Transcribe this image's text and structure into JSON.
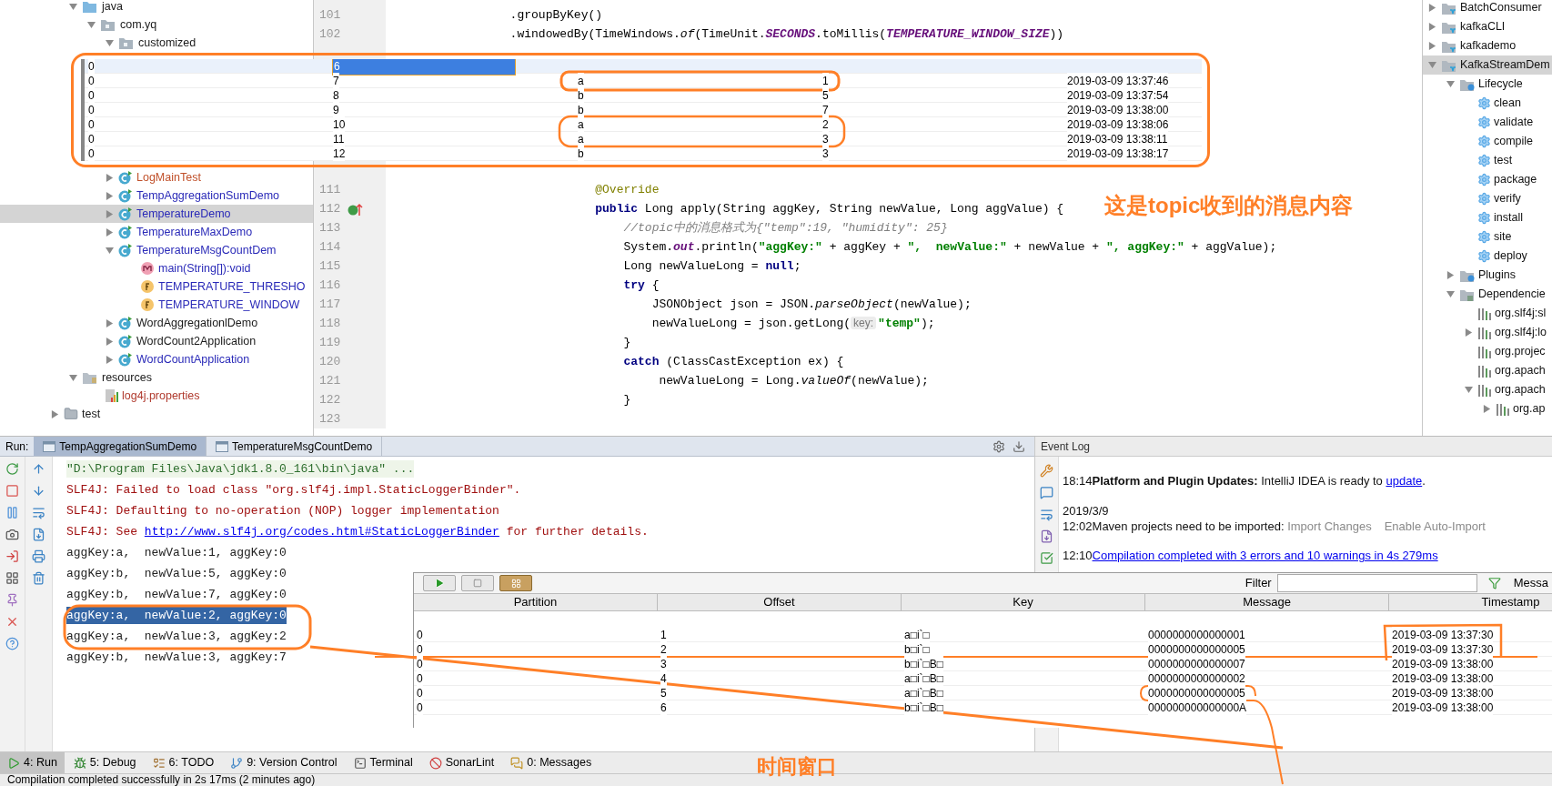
{
  "project_tree": {
    "items": [
      {
        "label": "java",
        "kind": "source-folder",
        "expanded": true,
        "selected": false,
        "children": [
          {
            "label": "com.yq",
            "kind": "package",
            "expanded": true,
            "selected": false,
            "children": [
              {
                "label": "customized",
                "kind": "package",
                "expanded": true,
                "selected": false
              },
              {
                "label": "LogMainTest",
                "kind": "class",
                "expanded": false,
                "selected": false,
                "color": "#c0502a"
              },
              {
                "label": "TempAggregationSumDemo",
                "kind": "class",
                "expanded": false,
                "selected": false,
                "color": "#2a2ab8"
              },
              {
                "label": "TemperatureDemo",
                "kind": "class",
                "expanded": false,
                "selected": true,
                "color": "#2a2ab8"
              },
              {
                "label": "TemperatureMaxDemo",
                "kind": "class",
                "expanded": false,
                "selected": false,
                "color": "#2a2ab8"
              },
              {
                "label": "TemperatureMsgCountDem",
                "kind": "class",
                "expanded": true,
                "selected": false,
                "color": "#2a2ab8",
                "children": [
                  {
                    "label": "main(String[]):void",
                    "kind": "method",
                    "selected": false,
                    "color": "#2a2ab8"
                  },
                  {
                    "label": "TEMPERATURE_THRESHO",
                    "kind": "field",
                    "selected": false,
                    "color": "#2a2ab8"
                  },
                  {
                    "label": "TEMPERATURE_WINDOW",
                    "kind": "field",
                    "selected": false,
                    "color": "#2a2ab8"
                  }
                ]
              },
              {
                "label": "WordAggregationlDemo",
                "kind": "class",
                "expanded": false,
                "selected": false,
                "color": "#1a1a1a"
              },
              {
                "label": "WordCount2Application",
                "kind": "class",
                "expanded": false,
                "selected": false,
                "color": "#1a1a1a"
              },
              {
                "label": "WordCountApplication",
                "kind": "class",
                "expanded": false,
                "selected": false,
                "color": "#2a2ab8"
              }
            ]
          }
        ]
      },
      {
        "label": "resources",
        "kind": "resource-folder",
        "expanded": true,
        "selected": false,
        "children": [
          {
            "label": "log4j.properties",
            "kind": "properties",
            "selected": false,
            "color": "#b03a2e"
          }
        ]
      }
    ],
    "after": [
      {
        "label": "test",
        "kind": "folder",
        "expanded": false,
        "selected": false,
        "color": "#1a1a1a"
      }
    ]
  },
  "editor": {
    "top_lines": [
      {
        "number": "101",
        "segments": [
          {
            "kind": "plain",
            "text": "                 .groupByKey()"
          }
        ]
      },
      {
        "number": "102",
        "segments": [
          {
            "kind": "plain",
            "text": "                 .windowedBy(TimeWindows."
          },
          {
            "kind": "italic",
            "text": "of"
          },
          {
            "kind": "plain",
            "text": "(TimeUnit."
          },
          {
            "kind": "static",
            "text": "SECONDS"
          },
          {
            "kind": "plain",
            "text": ".toMillis("
          },
          {
            "kind": "static",
            "text": "TEMPERATURE_WINDOW_SIZE"
          },
          {
            "kind": "plain",
            "text": "))"
          }
        ]
      }
    ],
    "lines": [
      {
        "number": "111",
        "segments": [
          {
            "kind": "annotation",
            "text": "                             @Override"
          }
        ]
      },
      {
        "number": "112",
        "gutter_mark": true,
        "segments": [
          {
            "kind": "keyword",
            "text": "                             public"
          },
          {
            "kind": "plain",
            "text": " Long apply(String aggKey, String newValue, Long aggValue) {"
          }
        ]
      },
      {
        "number": "113",
        "segments": [
          {
            "kind": "comment",
            "text": "                                 //topic中的消息格式为{\"temp\":19, \"humidity\": 25}"
          }
        ]
      },
      {
        "number": "114",
        "segments": [
          {
            "kind": "plain",
            "text": "                                 System."
          },
          {
            "kind": "static",
            "text": "out"
          },
          {
            "kind": "plain",
            "text": ".println("
          },
          {
            "kind": "string",
            "text": "\"aggKey:\""
          },
          {
            "kind": "plain",
            "text": " + aggKey + "
          },
          {
            "kind": "string",
            "text": "\",  newValue:\""
          },
          {
            "kind": "plain",
            "text": " + newValue + "
          },
          {
            "kind": "string",
            "text": "\", aggKey:\""
          },
          {
            "kind": "plain",
            "text": " + aggValue);"
          }
        ]
      },
      {
        "number": "115",
        "segments": [
          {
            "kind": "plain",
            "text": "                                 Long newValueLong = "
          },
          {
            "kind": "keyword",
            "text": "null"
          },
          {
            "kind": "plain",
            "text": ";"
          }
        ]
      },
      {
        "number": "116",
        "segments": [
          {
            "kind": "keyword",
            "text": "                                 try"
          },
          {
            "kind": "plain",
            "text": " {"
          }
        ]
      },
      {
        "number": "117",
        "segments": [
          {
            "kind": "plain",
            "text": "                                     JSONObject json = JSON."
          },
          {
            "kind": "italic",
            "text": "parseObject"
          },
          {
            "kind": "plain",
            "text": "(newValue);"
          }
        ]
      },
      {
        "number": "118",
        "segments": [
          {
            "kind": "plain",
            "text": "                                     newValueLong = json.getLong("
          },
          {
            "kind": "hint",
            "text": "key:"
          },
          {
            "kind": "string",
            "text": "\"temp\""
          },
          {
            "kind": "plain",
            "text": ");"
          }
        ]
      },
      {
        "number": "119",
        "segments": [
          {
            "kind": "plain",
            "text": "                                 }"
          }
        ]
      },
      {
        "number": "120",
        "segments": [
          {
            "kind": "keyword",
            "text": "                                 catch"
          },
          {
            "kind": "plain",
            "text": " (ClassCastException ex) {"
          }
        ]
      },
      {
        "number": "121",
        "segments": [
          {
            "kind": "plain",
            "text": "                                      newValueLong = Long."
          },
          {
            "kind": "italic",
            "text": "valueOf"
          },
          {
            "kind": "plain",
            "text": "(newValue);"
          }
        ]
      },
      {
        "number": "122",
        "segments": [
          {
            "kind": "plain",
            "text": "                                 }"
          }
        ]
      },
      {
        "number": "123"
      }
    ]
  },
  "maven_tree": {
    "items": [
      {
        "label": "BatchConsumer",
        "kind": "module",
        "expanded": false,
        "selected": false
      },
      {
        "label": "kafkaCLI",
        "kind": "module",
        "expanded": false,
        "selected": false
      },
      {
        "label": "kafkademo",
        "kind": "module",
        "expanded": false,
        "selected": false
      },
      {
        "label": "KafkaStreamDem",
        "kind": "module",
        "expanded": true,
        "selected": true,
        "children": [
          {
            "label": "Lifecycle",
            "kind": "lifecycle",
            "expanded": true,
            "selected": false,
            "children": [
              {
                "label": "clean",
                "kind": "goal",
                "selected": false
              },
              {
                "label": "validate",
                "kind": "goal",
                "selected": false
              },
              {
                "label": "compile",
                "kind": "goal",
                "selected": false
              },
              {
                "label": "test",
                "kind": "goal",
                "selected": false
              },
              {
                "label": "package",
                "kind": "goal",
                "selected": false
              },
              {
                "label": "verify",
                "kind": "goal",
                "selected": false
              },
              {
                "label": "install",
                "kind": "goal",
                "selected": false
              },
              {
                "label": "site",
                "kind": "goal",
                "selected": false
              },
              {
                "label": "deploy",
                "kind": "goal",
                "selected": false
              }
            ]
          },
          {
            "label": "Plugins",
            "kind": "lifecycle",
            "expanded": false,
            "selected": false
          },
          {
            "label": "Dependencie",
            "kind": "dependencies",
            "expanded": true,
            "selected": false,
            "children": [
              {
                "label": "org.slf4j:sl",
                "kind": "library",
                "selected": false
              },
              {
                "label": "org.slf4j:lo",
                "kind": "library",
                "expanded": false,
                "selected": false
              },
              {
                "label": "org.projec",
                "kind": "library",
                "selected": false
              },
              {
                "label": "org.apach",
                "kind": "library",
                "selected": false
              },
              {
                "label": "org.apach",
                "kind": "library",
                "expanded": true,
                "selected": false,
                "children": [
                  {
                    "label": "org.ap",
                    "kind": "library",
                    "expanded": false,
                    "selected": false
                  }
                ]
              }
            ]
          }
        ]
      }
    ]
  },
  "topic_table": {
    "rows": [
      {
        "selected": true,
        "cells": [
          "0",
          "6"
        ]
      },
      {
        "selected": false,
        "cells": [
          "0",
          "7",
          "a",
          "1",
          "2019-03-09 13:37:46"
        ]
      },
      {
        "selected": false,
        "cells": [
          "0",
          "8",
          "b",
          "5",
          "2019-03-09 13:37:54"
        ]
      },
      {
        "selected": false,
        "cells": [
          "0",
          "9",
          "b",
          "7",
          "2019-03-09 13:38:00"
        ]
      },
      {
        "selected": false,
        "cells": [
          "0",
          "10",
          "a",
          "2",
          "2019-03-09 13:38:06"
        ]
      },
      {
        "selected": false,
        "cells": [
          "0",
          "11",
          "a",
          "3",
          "2019-03-09 13:38:11"
        ]
      },
      {
        "selected": false,
        "cells": [
          "0",
          "12",
          "b",
          "3",
          "2019-03-09 13:38:17"
        ]
      }
    ]
  },
  "annotation": {
    "note": "这是topic收到的消息内容",
    "bottom_note": "时间窗口"
  },
  "run_panel": {
    "label": "Run:",
    "tabs": [
      {
        "label": "TempAggregationSumDemo",
        "selected": true
      },
      {
        "label": "TemperatureMsgCountDemo",
        "selected": false
      }
    ],
    "console": [
      {
        "kind": "command",
        "selected": false,
        "segments": [
          {
            "kind": "text",
            "text": "\"D:\\Program Files\\Java\\jdk1.8.0_161\\bin\\java\" ..."
          }
        ]
      },
      {
        "kind": "error",
        "selected": false,
        "segments": [
          {
            "kind": "text",
            "text": "SLF4J: Failed to load class \"org.slf4j.impl.StaticLoggerBinder\"."
          }
        ]
      },
      {
        "kind": "error",
        "selected": false,
        "segments": [
          {
            "kind": "text",
            "text": "SLF4J: Defaulting to no-operation (NOP) logger implementation"
          }
        ]
      },
      {
        "kind": "error",
        "selected": false,
        "segments": [
          {
            "kind": "text",
            "text": "SLF4J: See "
          },
          {
            "kind": "link",
            "text": "http://www.slf4j.org/codes.html#StaticLoggerBinder"
          },
          {
            "kind": "text",
            "text": " for further details."
          }
        ]
      },
      {
        "kind": "output",
        "selected": false,
        "segments": [
          {
            "kind": "text",
            "text": "aggKey:a,  newValue:1, aggKey:0"
          }
        ]
      },
      {
        "kind": "output",
        "selected": false,
        "segments": [
          {
            "kind": "text",
            "text": "aggKey:b,  newValue:5, aggKey:0"
          }
        ]
      },
      {
        "kind": "output",
        "selected": false,
        "segments": [
          {
            "kind": "text",
            "text": "aggKey:b,  newValue:7, aggKey:0"
          }
        ]
      },
      {
        "kind": "output",
        "selected": true,
        "segments": [
          {
            "kind": "text",
            "text": "aggKey:a,  newValue:2, aggKey:0"
          }
        ]
      },
      {
        "kind": "output",
        "selected": false,
        "segments": [
          {
            "kind": "text",
            "text": "aggKey:a,  newValue:3, aggKey:2"
          }
        ]
      },
      {
        "kind": "output",
        "selected": false,
        "segments": [
          {
            "kind": "text",
            "text": "aggKey:b,  newValue:3, aggKey:7"
          }
        ]
      }
    ]
  },
  "event_log": {
    "title": "Event Log",
    "entries": [
      {
        "time": "18:14",
        "segments": [
          {
            "kind": "bold",
            "text": "Platform and Plugin Updates:"
          },
          {
            "kind": "text",
            "text": " IntelliJ IDEA is ready to "
          },
          {
            "kind": "link",
            "text": "update"
          },
          {
            "kind": "text",
            "text": "."
          }
        ]
      },
      {
        "date": "2019/3/9",
        "time": "12:02",
        "segments": [
          {
            "kind": "text",
            "text": "Maven projects need to be imported: "
          },
          {
            "kind": "action",
            "text": "Import Changes"
          },
          {
            "kind": "action",
            "text": "Enable Auto-Import"
          }
        ]
      },
      {
        "time": "12:10",
        "segments": [
          {
            "kind": "link",
            "text": "Compilation completed with 3 errors and 10 warnings in 4s 279ms"
          }
        ]
      }
    ]
  },
  "message_table": {
    "filter_label": "Filter",
    "column_6": "Messa",
    "columns": [
      "Partition",
      "Offset",
      "Key",
      "Message",
      "Timestamp"
    ],
    "rows": [
      {
        "cells": [
          "0",
          "1",
          "a□i`□",
          "0000000000000001",
          "2019-03-09 13:37:30"
        ]
      },
      {
        "cells": [
          "0",
          "2",
          "b□i`□",
          "0000000000000005",
          "2019-03-09 13:37:30"
        ]
      },
      {
        "cells": [
          "0",
          "3",
          "b□i`□B□",
          "0000000000000007",
          "2019-03-09 13:38:00"
        ]
      },
      {
        "cells": [
          "0",
          "4",
          "a□i`□B□",
          "0000000000000002",
          "2019-03-09 13:38:00"
        ]
      },
      {
        "cells": [
          "0",
          "5",
          "a□i`□B□",
          "0000000000000005",
          "2019-03-09 13:38:00"
        ]
      },
      {
        "cells": [
          "0",
          "6",
          "b□i`□B□",
          "000000000000000A",
          "2019-03-09 13:38:00"
        ]
      }
    ]
  },
  "tool_windows": [
    {
      "label": "4: Run",
      "kind": "run",
      "selected": true
    },
    {
      "label": "5: Debug",
      "kind": "debug",
      "selected": false
    },
    {
      "label": "6: TODO",
      "kind": "todo",
      "selected": false
    },
    {
      "label": "9: Version Control",
      "kind": "vcs",
      "selected": false
    },
    {
      "label": "Terminal",
      "kind": "terminal",
      "selected": false
    },
    {
      "label": "SonarLint",
      "kind": "sonar",
      "selected": false
    },
    {
      "label": "0: Messages",
      "kind": "messages",
      "selected": false
    }
  ],
  "status_bar": "Compilation completed successfully in 2s 17ms (2 minutes ago)"
}
